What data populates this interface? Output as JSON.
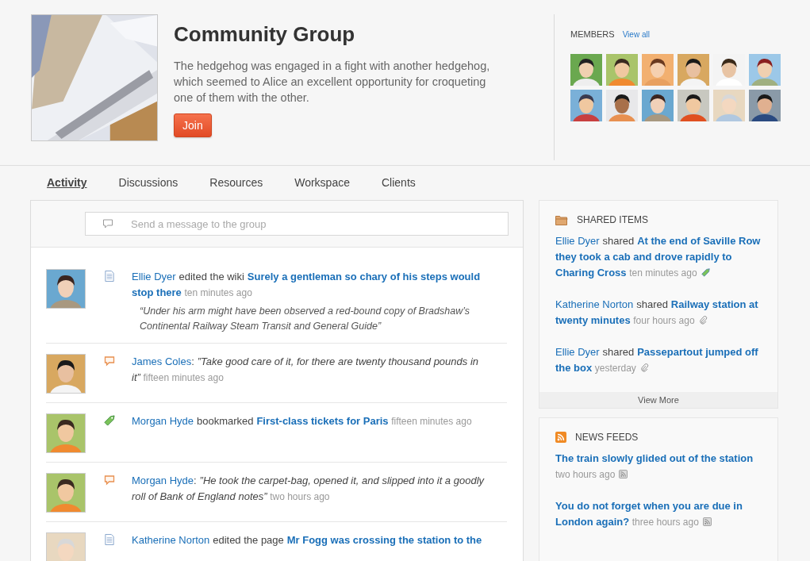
{
  "group": {
    "title": "Community Group",
    "description": "The hedgehog was engaged in a fight with another hedgehog, which seemed to Alice an excellent opportunity for croqueting one of them with the other.",
    "join_button": "Join"
  },
  "members": {
    "title": "MEMBERS",
    "view_all": "View all"
  },
  "tabs": [
    {
      "label": "Activity",
      "selected": true
    },
    {
      "label": "Discussions",
      "selected": false
    },
    {
      "label": "Resources",
      "selected": false
    },
    {
      "label": "Workspace",
      "selected": false
    },
    {
      "label": "Clients",
      "selected": false
    }
  ],
  "message_field": {
    "placeholder": "Send a message to the group"
  },
  "activity": [
    {
      "kind": "edit",
      "actor": "Ellie Dyer",
      "verb": "edited the wiki",
      "target": "Surely a gentleman so chary of his steps would stop there",
      "time": "ten minutes ago",
      "quote": "“Under his arm might have been observed a red-bound copy of Bradshaw’s Continental Railway Steam Transit and General Guide”"
    },
    {
      "kind": "comment",
      "actor": "James Coles",
      "verb": ":",
      "quote": "”Take good care of it, for there are twenty thousand pounds in it”",
      "time": "fifteen minutes ago"
    },
    {
      "kind": "bookmark",
      "actor": "Morgan Hyde",
      "verb": "bookmarked",
      "target": "First-class tickets for Paris",
      "time": "fifteen minutes ago"
    },
    {
      "kind": "comment",
      "actor": "Morgan Hyde",
      "verb": ":",
      "quote": "”He took the carpet-bag, opened it, and slipped into it a goodly roll of Bank of England notes”",
      "time": "two hours ago"
    },
    {
      "kind": "edit",
      "actor": "Katherine Norton",
      "verb": "edited the page",
      "target": "Mr Fogg was crossing the station to the"
    }
  ],
  "shared_items": {
    "title": "SHARED ITEMS",
    "items": [
      {
        "kind": "tag",
        "actor": "Ellie Dyer",
        "verb": "shared",
        "target": "At the end of Saville Row they took a cab and drove rapidly to Charing Cross",
        "time": "ten minutes ago"
      },
      {
        "kind": "clip",
        "actor": "Katherine Norton",
        "verb": "shared",
        "target": "Railway station at twenty minutes",
        "time": "four hours ago"
      },
      {
        "kind": "clip",
        "actor": "Ellie Dyer",
        "verb": "shared",
        "target": "Passepartout jumped off the box",
        "time": "yesterday"
      }
    ],
    "view_more": "View More"
  },
  "news_feeds": {
    "title": "NEWS FEEDS",
    "items": [
      {
        "title": "The train slowly glided out of the station",
        "time": "two hours ago"
      },
      {
        "title": "You do not forget when you are due in London again?",
        "time": "three hours ago"
      }
    ]
  }
}
